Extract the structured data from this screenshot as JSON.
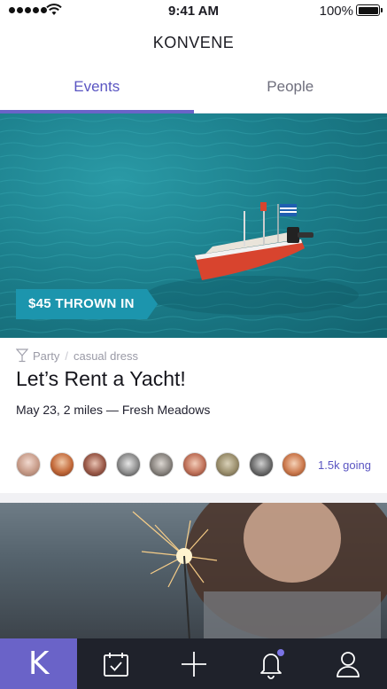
{
  "status_bar": {
    "time": "9:41 AM",
    "battery": "100%"
  },
  "header": {
    "title": "KONVENE"
  },
  "tabs": [
    {
      "label": "Events",
      "active": true
    },
    {
      "label": "People",
      "active": false
    }
  ],
  "events": [
    {
      "price_tag": "$45 THROWN IN",
      "category": "Party",
      "dress_code": "casual dress",
      "title": "Let’s Rent a Yacht!",
      "details": "May 23, 2 miles — Fresh Meadows",
      "attendee_count": 9,
      "going_label": "1.5k going"
    }
  ],
  "bottom_nav": {
    "home_letter": "K",
    "items": [
      "home",
      "calendar-check-icon",
      "plus-icon",
      "bell-icon",
      "profile-icon"
    ],
    "bell_has_notification": true
  },
  "colors": {
    "accent": "#6a63c8",
    "accent_text": "#5a55c2",
    "price_tag": "#1c95ad",
    "nav_background": "#1f222b"
  }
}
